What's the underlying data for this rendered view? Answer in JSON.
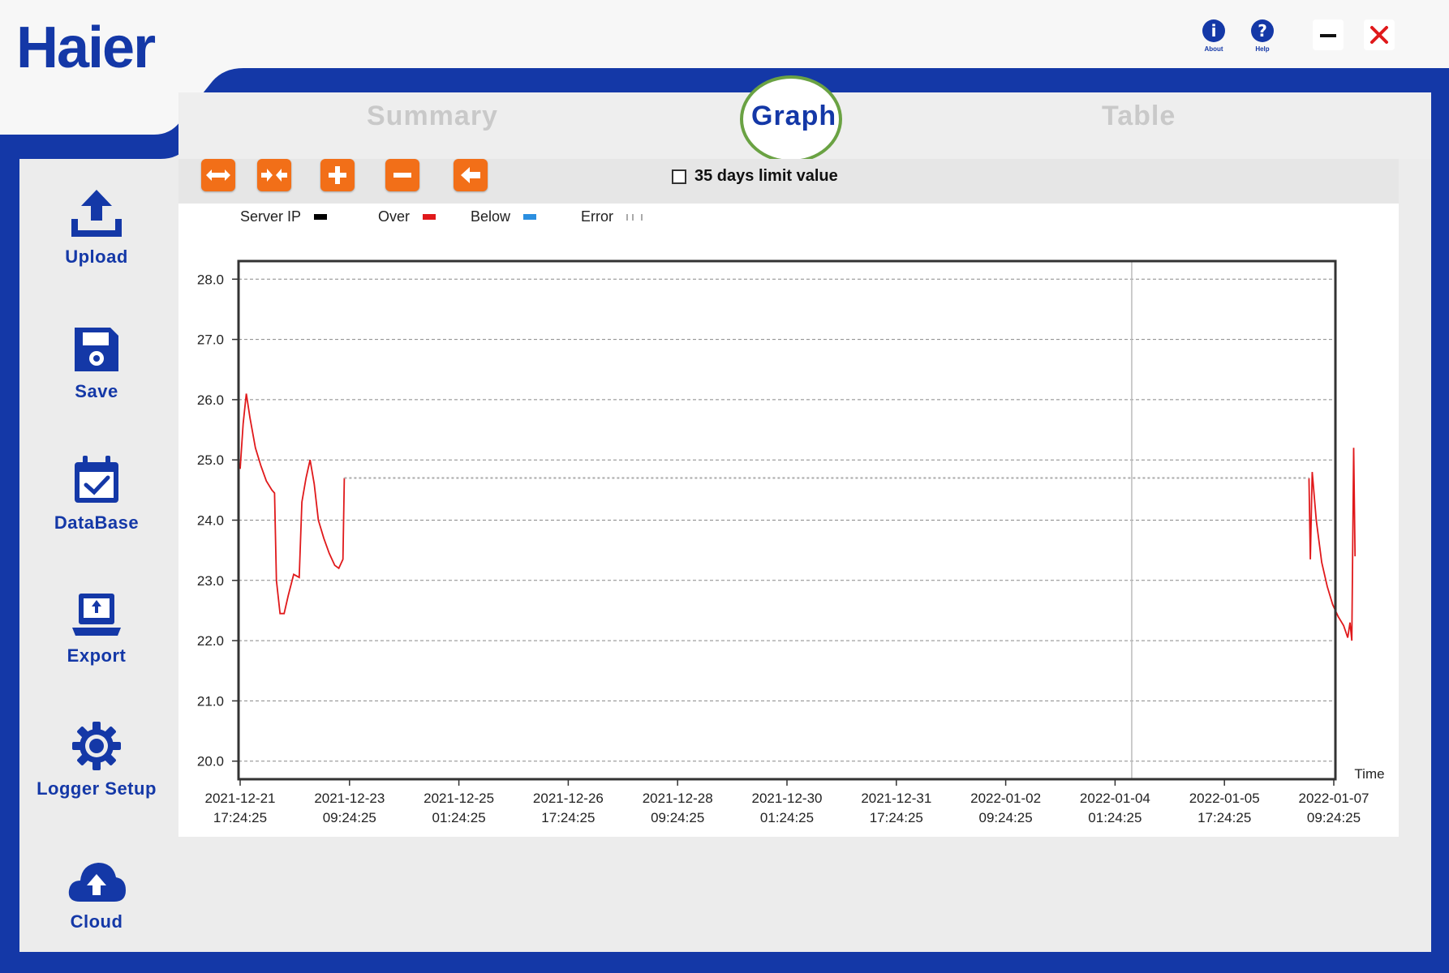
{
  "app": {
    "logo_text": "Haier"
  },
  "window_controls": {
    "about_label": "About",
    "help_label": "Help",
    "about_symbol": "i",
    "help_symbol": "?",
    "minimize_symbol": "—",
    "close_symbol": "✕"
  },
  "tabs": [
    {
      "label": "Summary",
      "active": false
    },
    {
      "label": "Graph",
      "active": true
    },
    {
      "label": "Table",
      "active": false
    }
  ],
  "sidebar": {
    "items": [
      {
        "label": "Upload",
        "icon": "upload-icon"
      },
      {
        "label": "Save",
        "icon": "floppy-disk-icon"
      },
      {
        "label": "DataBase",
        "icon": "calendar-check-icon"
      },
      {
        "label": "Export",
        "icon": "laptop-export-icon"
      },
      {
        "label": "Logger Setup",
        "icon": "gear-icon"
      },
      {
        "label": "Cloud",
        "icon": "cloud-upload-icon"
      }
    ]
  },
  "toolbar": {
    "buttons": [
      {
        "icon": "expand-horizontal-icon"
      },
      {
        "icon": "collapse-horizontal-icon"
      },
      {
        "icon": "zoom-in-plus-icon"
      },
      {
        "icon": "zoom-out-minus-icon"
      },
      {
        "icon": "back-arrow-icon"
      }
    ],
    "limit_checkbox_label": "35 days limit value",
    "limit_checkbox_checked": false
  },
  "legend": [
    {
      "label": "Server IP",
      "color": "#000000"
    },
    {
      "label": "Over",
      "color": "#e0191b"
    },
    {
      "label": "Below",
      "color": "#2b8fe0"
    },
    {
      "label": "Error",
      "color": "#aaaaaa"
    }
  ],
  "colors": {
    "brand_blue": "#1438a7",
    "tool_orange": "#f26f18",
    "tab_ring_green": "#6aa243",
    "series_red": "#e0191b"
  },
  "chart_data": {
    "type": "line",
    "xlabel": "Time",
    "ylabel": "",
    "ylim": [
      19.7,
      28.3
    ],
    "yticks": [
      "28.0",
      "27.0",
      "26.0",
      "25.0",
      "24.0",
      "23.0",
      "22.0",
      "21.0",
      "20.0"
    ],
    "xticks": [
      [
        "2021-12-21",
        "17:24:25"
      ],
      [
        "2021-12-23",
        "09:24:25"
      ],
      [
        "2021-12-25",
        "01:24:25"
      ],
      [
        "2021-12-26",
        "17:24:25"
      ],
      [
        "2021-12-28",
        "09:24:25"
      ],
      [
        "2021-12-30",
        "01:24:25"
      ],
      [
        "2021-12-31",
        "17:24:25"
      ],
      [
        "2022-01-02",
        "09:24:25"
      ],
      [
        "2022-01-04",
        "01:24:25"
      ],
      [
        "2022-01-05",
        "17:24:25"
      ],
      [
        "2022-01-07",
        "09:24:25"
      ]
    ],
    "xlim": [
      "2021-12-21 17:24:25",
      "2022-01-07 18:00:00"
    ],
    "grid": true,
    "series": [
      {
        "name": "Over",
        "color": "#e0191b",
        "segments": [
          [
            [
              "2021-12-21 17:24:25",
              24.85
            ],
            [
              "2021-12-21 18:30:00",
              25.6
            ],
            [
              "2021-12-21 19:40:00",
              26.1
            ],
            [
              "2021-12-21 21:00:00",
              25.7
            ],
            [
              "2021-12-21 23:00:00",
              25.2
            ],
            [
              "2021-12-22 01:00:00",
              24.9
            ],
            [
              "2021-12-22 03:00:00",
              24.65
            ],
            [
              "2021-12-22 05:00:00",
              24.5
            ],
            [
              "2021-12-22 06:00:00",
              24.45
            ],
            [
              "2021-12-22 06:40:00",
              23.0
            ],
            [
              "2021-12-22 08:00:00",
              22.45
            ],
            [
              "2021-12-22 09:30:00",
              22.45
            ],
            [
              "2021-12-22 11:00:00",
              22.75
            ],
            [
              "2021-12-22 13:00:00",
              23.1
            ],
            [
              "2021-12-22 15:00:00",
              23.05
            ],
            [
              "2021-12-22 16:00:00",
              24.3
            ],
            [
              "2021-12-22 17:30:00",
              24.7
            ],
            [
              "2021-12-22 19:00:00",
              25.0
            ],
            [
              "2021-12-22 20:30:00",
              24.6
            ],
            [
              "2021-12-22 22:00:00",
              24.0
            ],
            [
              "2021-12-23 00:00:00",
              23.7
            ],
            [
              "2021-12-23 02:00:00",
              23.45
            ],
            [
              "2021-12-23 04:00:00",
              23.25
            ],
            [
              "2021-12-23 05:30:00",
              23.2
            ],
            [
              "2021-12-23 07:00:00",
              23.35
            ],
            [
              "2021-12-23 07:30:00",
              24.7
            ]
          ],
          [
            [
              "2022-01-07 00:20:00",
              24.7
            ],
            [
              "2022-01-07 00:50:00",
              23.35
            ],
            [
              "2022-01-07 01:30:00",
              24.8
            ],
            [
              "2022-01-07 03:00:00",
              24.0
            ],
            [
              "2022-01-07 05:00:00",
              23.3
            ],
            [
              "2022-01-07 07:00:00",
              22.9
            ],
            [
              "2022-01-07 09:00:00",
              22.6
            ],
            [
              "2022-01-07 11:00:00",
              22.4
            ],
            [
              "2022-01-07 13:00:00",
              22.25
            ],
            [
              "2022-01-07 14:30:00",
              22.05
            ],
            [
              "2022-01-07 15:20:00",
              22.3
            ],
            [
              "2022-01-07 16:00:00",
              22.0
            ],
            [
              "2022-01-07 16:40:00",
              25.2
            ],
            [
              "2022-01-07 17:10:00",
              23.4
            ]
          ]
        ]
      },
      {
        "name": "Error",
        "color": "#aaaaaa",
        "dashed": true,
        "segments": [
          [
            [
              "2021-12-23 07:30:00",
              24.7
            ],
            [
              "2022-01-07 00:20:00",
              24.7
            ]
          ]
        ]
      }
    ],
    "marker_time": "2022-01-04 07:30:00"
  }
}
